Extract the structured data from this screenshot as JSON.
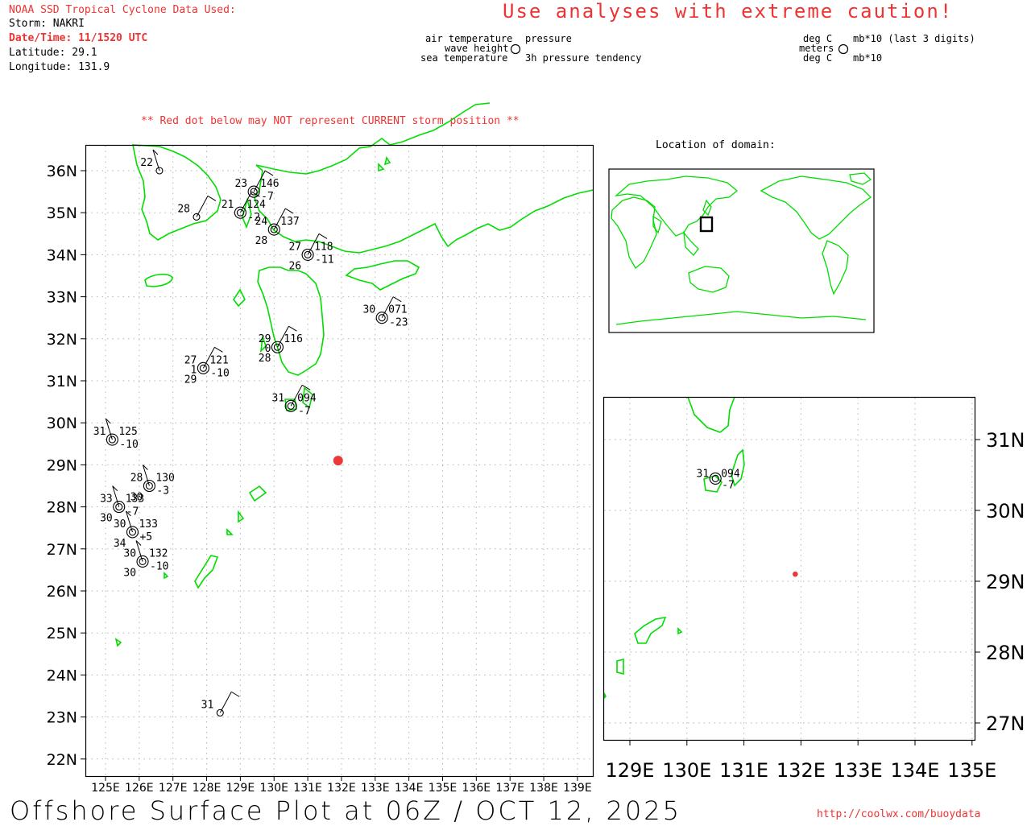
{
  "header": {
    "source_title": "NOAA SSD Tropical Cyclone Data Used:",
    "storm_line": "Storm: NAKRI",
    "datetime_line": "Date/Time: 11/1520 UTC",
    "latitude_line": "Latitude: 29.1",
    "longitude_line": "Longitude: 131.9",
    "caution": "Use analyses with extreme caution!",
    "red_dot_warning": "** Red dot below may NOT represent CURRENT storm position **"
  },
  "legend": {
    "air_temperature": "air temperature",
    "wave_height": "wave height",
    "sea_temperature": "sea temperature",
    "pressure": "pressure",
    "pressure_tendency": "3h pressure tendency",
    "unit_degc_top": "deg C",
    "unit_meters": "meters",
    "unit_degc_bottom": "deg C",
    "unit_pressure": "mb*10 (last 3 digits)",
    "unit_tendency": "mb*10"
  },
  "location_map": {
    "title": "Location of domain:"
  },
  "main_map": {
    "lat_labels": [
      "36N",
      "35N",
      "34N",
      "33N",
      "32N",
      "31N",
      "30N",
      "29N",
      "28N",
      "27N",
      "26N",
      "25N",
      "24N",
      "23N",
      "22N"
    ],
    "lon_labels": [
      "125E",
      "126E",
      "127E",
      "128E",
      "129E",
      "130E",
      "131E",
      "132E",
      "133E",
      "134E",
      "135E",
      "136E",
      "137E",
      "138E",
      "139E"
    ],
    "storm_position": {
      "lat": 29.1,
      "lon": 131.9,
      "color": "#e83a3a"
    },
    "stations": [
      {
        "lon": 126.6,
        "lat": 36.0,
        "air": "22"
      },
      {
        "lon": 129.4,
        "lat": 35.5,
        "air": "23",
        "pres": "146",
        "tend": "-7"
      },
      {
        "lon": 129.0,
        "lat": 35.0,
        "air": "21",
        "pres": "124",
        "tend": "-2"
      },
      {
        "lon": 127.7,
        "lat": 34.9,
        "air": "28"
      },
      {
        "lon": 130.0,
        "lat": 34.6,
        "air": "24",
        "pres": "137",
        "sea": "28"
      },
      {
        "lon": 131.0,
        "lat": 34.0,
        "air": "27",
        "pres": "118",
        "tend": "-11",
        "sea": "26"
      },
      {
        "lon": 133.2,
        "lat": 32.5,
        "air": "30",
        "pres": "071",
        "tend": "-23"
      },
      {
        "lon": 130.1,
        "lat": 31.8,
        "air": "29",
        "pres": "116",
        "sea": "28",
        "wave": "0"
      },
      {
        "lon": 127.9,
        "lat": 31.3,
        "air": "27",
        "pres": "121",
        "tend": "-10",
        "sea": "29",
        "wave": "1"
      },
      {
        "lon": 130.5,
        "lat": 30.4,
        "air": "31",
        "pres": "094",
        "tend": "-7"
      },
      {
        "lon": 125.2,
        "lat": 29.6,
        "air": "31",
        "pres": "125",
        "tend": "-10"
      },
      {
        "lon": 126.3,
        "lat": 28.5,
        "air": "28",
        "pres": "130",
        "tend": "-3",
        "sea": "30"
      },
      {
        "lon": 125.4,
        "lat": 28.0,
        "air": "33",
        "pres": "133",
        "tend": "-7",
        "sea": "30"
      },
      {
        "lon": 125.8,
        "lat": 27.4,
        "air": "30",
        "pres": "133",
        "tend": "+5",
        "sea": "34"
      },
      {
        "lon": 126.1,
        "lat": 26.7,
        "air": "30",
        "pres": "132",
        "tend": "-10",
        "sea": "30"
      },
      {
        "lon": 128.4,
        "lat": 23.1,
        "air": "31"
      }
    ]
  },
  "inset_map": {
    "lat_labels": [
      "31N",
      "30N",
      "29N",
      "28N",
      "27N"
    ],
    "lon_labels": [
      "129E",
      "130E",
      "131E",
      "132E",
      "133E",
      "134E",
      "135E"
    ],
    "station": {
      "air": "31",
      "pres": "094",
      "tend": "-7"
    }
  },
  "footer": {
    "plot_title": "Offshore Surface Plot at 06Z / OCT 12, 2025",
    "url": "http://coolwx.com/buoydata"
  },
  "colors": {
    "coast": "#00dd00",
    "warning": "#e83a3a",
    "grid": "#b0b0b0"
  }
}
